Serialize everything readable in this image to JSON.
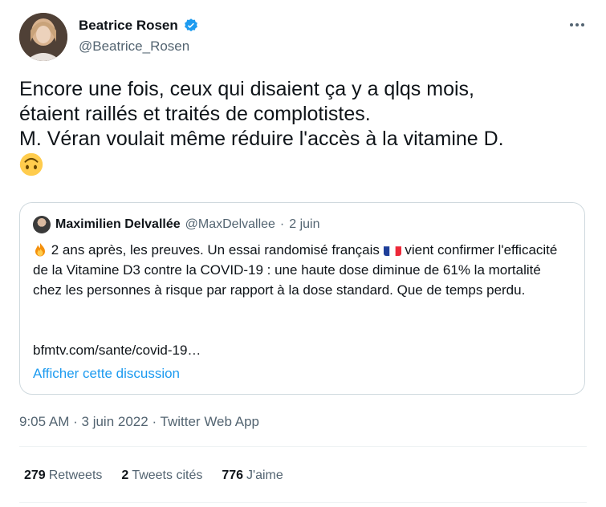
{
  "author": {
    "name": "Beatrice Rosen",
    "handle": "@Beatrice_Rosen",
    "verified": true
  },
  "tweet": {
    "text": "Encore une fois, ceux qui disaient ça y a qlqs mois,\nétaient raillés et traités de complotistes.\nM. Véran voulait même réduire l'accès à la vitamine D.",
    "emoji": "upside-down-face-icon"
  },
  "quote": {
    "name": "Maximilien Delvallée",
    "handle": "@MaxDelvallee",
    "separator": "·",
    "date": "2 juin",
    "text_part1": "2 ans après, les preuves. Un essai randomisé français",
    "text_part2": "vient confirmer l'efficacité de la Vitamine D3 contre la COVID-19 : une haute dose diminue de 61% la mortalité chez les personnes à risque par rapport à la dose standard. Que de temps perdu.",
    "link": "bfmtv.com/sante/covid-19…",
    "show_thread": "Afficher cette discussion"
  },
  "meta": {
    "time": "9:05 AM",
    "separator": "·",
    "date": "3 juin 2022",
    "app": "Twitter Web App"
  },
  "stats": {
    "retweets_count": "279",
    "retweets_label": "Retweets",
    "quotes_count": "2",
    "quotes_label": "Tweets cités",
    "likes_count": "776",
    "likes_label": "J'aime"
  },
  "colors": {
    "accent": "#1d9bf0",
    "secondary_text": "#536471",
    "border": "#cfd9de"
  }
}
